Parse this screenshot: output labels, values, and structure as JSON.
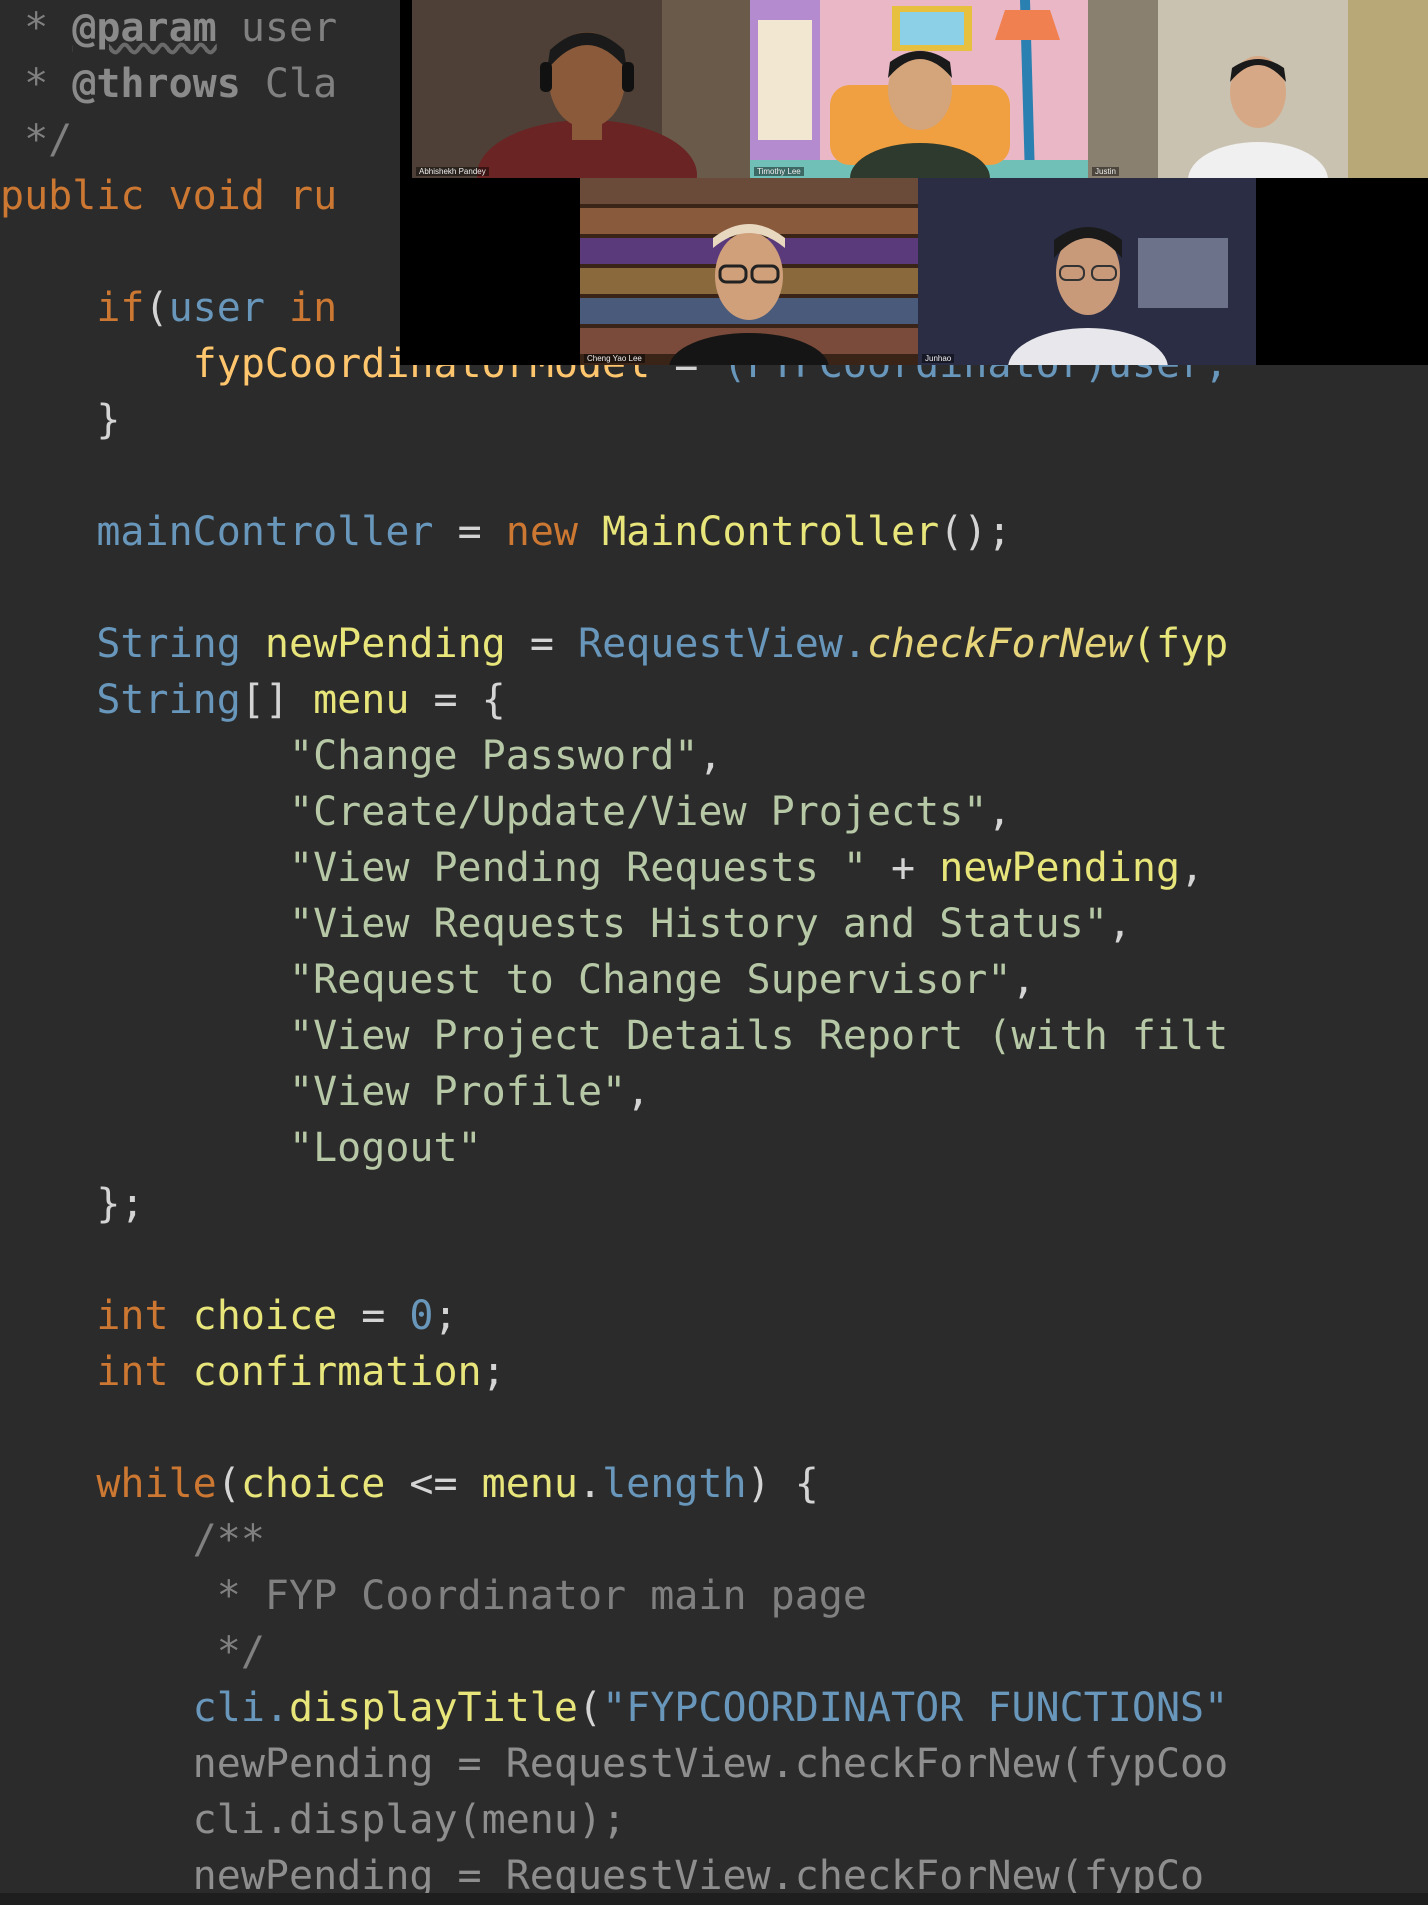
{
  "editor": {
    "lines": [
      {
        "tokens": [
          {
            "t": " * ",
            "c": "t-comment"
          },
          {
            "t": "@param",
            "c": "t-tag"
          },
          {
            "t": " user",
            "c": "t-comment"
          }
        ]
      },
      {
        "tokens": [
          {
            "t": " * ",
            "c": "t-comment"
          },
          {
            "t": "@throws",
            "c": "t-tag2"
          },
          {
            "t": " Cla",
            "c": "t-comment"
          }
        ]
      },
      {
        "tokens": [
          {
            "t": " */",
            "c": "t-comment"
          }
        ]
      },
      {
        "tokens": [
          {
            "t": "public ",
            "c": "t-kw"
          },
          {
            "t": "void ",
            "c": "t-kw"
          },
          {
            "t": "ru",
            "c": "t-kw"
          }
        ]
      },
      {
        "tokens": []
      },
      {
        "tokens": [
          {
            "t": "    if",
            "c": "t-kw"
          },
          {
            "t": "(",
            "c": "t-punct"
          },
          {
            "t": "user ",
            "c": "t-type"
          },
          {
            "t": "in",
            "c": "t-kw"
          }
        ]
      },
      {
        "tokens": [
          {
            "t": "        fypCoordinatorModel ",
            "c": "t-var"
          },
          {
            "t": "= ",
            "c": "t-punct"
          },
          {
            "t": "(FYPCoordinator)",
            "c": "t-type"
          },
          {
            "t": "user;",
            "c": "t-type"
          }
        ]
      },
      {
        "tokens": [
          {
            "t": "    }",
            "c": "t-punct"
          }
        ]
      },
      {
        "tokens": []
      },
      {
        "tokens": [
          {
            "t": "    mainController ",
            "c": "t-type"
          },
          {
            "t": "= ",
            "c": "t-punct"
          },
          {
            "t": "new ",
            "c": "t-kw"
          },
          {
            "t": "MainController",
            "c": "t-fn"
          },
          {
            "t": "();",
            "c": "t-punct"
          }
        ]
      },
      {
        "tokens": []
      },
      {
        "tokens": [
          {
            "t": "    String ",
            "c": "t-type"
          },
          {
            "t": "newPending ",
            "c": "t-fn"
          },
          {
            "t": "= ",
            "c": "t-punct"
          },
          {
            "t": "RequestView.",
            "c": "t-type"
          },
          {
            "t": "checkForNew",
            "c": "t-it"
          },
          {
            "t": "(fyp",
            "c": "t-fn"
          }
        ]
      },
      {
        "tokens": [
          {
            "t": "    String",
            "c": "t-type"
          },
          {
            "t": "[] ",
            "c": "t-punct"
          },
          {
            "t": "menu ",
            "c": "t-fn"
          },
          {
            "t": "= {",
            "c": "t-punct"
          }
        ]
      },
      {
        "tokens": [
          {
            "t": "            \"Change Password\"",
            "c": "t-str"
          },
          {
            "t": ",",
            "c": "t-punct"
          }
        ]
      },
      {
        "tokens": [
          {
            "t": "            \"Create/Update/View Projects\"",
            "c": "t-str"
          },
          {
            "t": ",",
            "c": "t-punct"
          }
        ]
      },
      {
        "tokens": [
          {
            "t": "            \"View Pending Requests \" ",
            "c": "t-str"
          },
          {
            "t": "+ ",
            "c": "t-punct"
          },
          {
            "t": "newPending",
            "c": "t-fn"
          },
          {
            "t": ",",
            "c": "t-punct"
          }
        ]
      },
      {
        "tokens": [
          {
            "t": "            \"View Requests History and Status\"",
            "c": "t-str"
          },
          {
            "t": ",",
            "c": "t-punct"
          }
        ]
      },
      {
        "tokens": [
          {
            "t": "            \"Request to Change Supervisor\"",
            "c": "t-str"
          },
          {
            "t": ",",
            "c": "t-punct"
          }
        ]
      },
      {
        "tokens": [
          {
            "t": "            \"View Project Details Report (with filt",
            "c": "t-str"
          }
        ]
      },
      {
        "tokens": [
          {
            "t": "            \"View Profile\"",
            "c": "t-str"
          },
          {
            "t": ",",
            "c": "t-punct"
          }
        ]
      },
      {
        "tokens": [
          {
            "t": "            \"Logout\"",
            "c": "t-str"
          }
        ]
      },
      {
        "tokens": [
          {
            "t": "    };",
            "c": "t-punct"
          }
        ]
      },
      {
        "tokens": []
      },
      {
        "tokens": [
          {
            "t": "    int ",
            "c": "t-kw"
          },
          {
            "t": "choice ",
            "c": "t-fn"
          },
          {
            "t": "= ",
            "c": "t-punct"
          },
          {
            "t": "0",
            "c": "t-num"
          },
          {
            "t": ";",
            "c": "t-punct"
          }
        ]
      },
      {
        "tokens": [
          {
            "t": "    int ",
            "c": "t-kw"
          },
          {
            "t": "confirmation",
            "c": "t-fn"
          },
          {
            "t": ";",
            "c": "t-punct"
          }
        ]
      },
      {
        "tokens": []
      },
      {
        "tokens": [
          {
            "t": "    while",
            "c": "t-kw"
          },
          {
            "t": "(",
            "c": "t-punct"
          },
          {
            "t": "choice ",
            "c": "t-fn"
          },
          {
            "t": "<= ",
            "c": "t-punct"
          },
          {
            "t": "menu",
            "c": "t-fn"
          },
          {
            "t": ".",
            "c": "t-punct"
          },
          {
            "t": "length",
            "c": "t-type"
          },
          {
            "t": ") {",
            "c": "t-punct"
          }
        ]
      },
      {
        "tokens": [
          {
            "t": "        /**",
            "c": "t-comment"
          }
        ]
      },
      {
        "tokens": [
          {
            "t": "         * FYP Coordinator main page",
            "c": "t-comment"
          }
        ]
      },
      {
        "tokens": [
          {
            "t": "         */",
            "c": "t-comment"
          }
        ]
      },
      {
        "tokens": [
          {
            "t": "        cli.",
            "c": "t-type"
          },
          {
            "t": "displayTitle",
            "c": "t-fn"
          },
          {
            "t": "(",
            "c": "t-punct"
          },
          {
            "t": "\"FYPCOORDINATOR FUNCTIONS\"",
            "c": "t-type"
          }
        ]
      },
      {
        "tokens": [
          {
            "t": "        newPending = RequestView.checkForNew(fypCoo",
            "c": "t-dim"
          }
        ]
      },
      {
        "tokens": [
          {
            "t": "        cli.display(menu);",
            "c": "t-dim"
          }
        ]
      },
      {
        "tokens": [
          {
            "t": "        newPending = RequestView.checkForNew(fypCo",
            "c": "t-dim"
          }
        ]
      }
    ]
  },
  "video_call": {
    "participants": [
      {
        "name": "Abhishekh Pandey",
        "bg": "#5a4a3e",
        "shirt": "#6b2424",
        "skin": "#8a5a3a"
      },
      {
        "name": "Timothy Lee",
        "bg": "#e9b6c6",
        "shirt": "#2d3a2d",
        "skin": "#d4a47a"
      },
      {
        "name": "Justin",
        "bg": "#c9c2b0",
        "shirt": "#f0f0f0",
        "skin": "#d6a886"
      },
      {
        "name": "Cheng Yao Lee",
        "bg": "#5a3a2a",
        "shirt": "#151515",
        "skin": "#d0a07a"
      },
      {
        "name": "Junhao",
        "bg": "#2d3046",
        "shirt": "#e8e8ec",
        "skin": "#c89a7a"
      }
    ]
  }
}
